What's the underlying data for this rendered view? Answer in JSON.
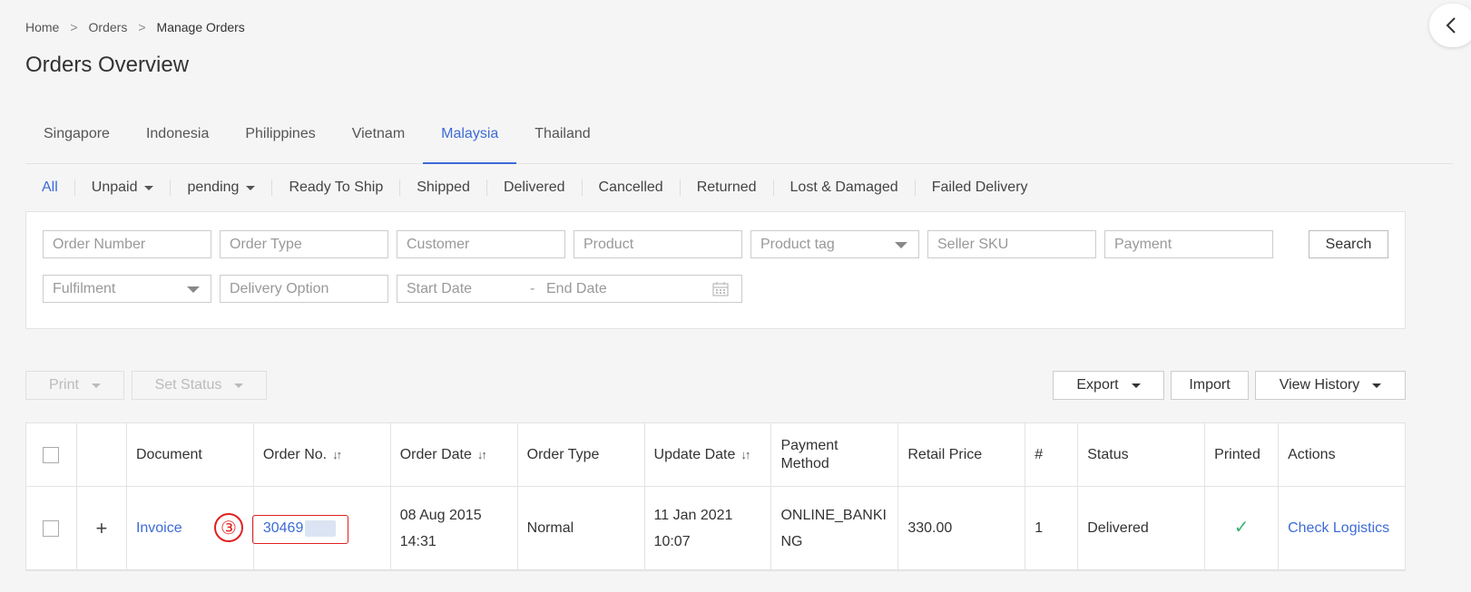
{
  "breadcrumb": [
    "Home",
    "Orders",
    "Manage Orders"
  ],
  "breadcrumb_sep": ">",
  "page_title": "Orders Overview",
  "country_tabs": [
    {
      "label": "Singapore",
      "active": false
    },
    {
      "label": "Indonesia",
      "active": false
    },
    {
      "label": "Philippines",
      "active": false
    },
    {
      "label": "Vietnam",
      "active": false
    },
    {
      "label": "Malaysia",
      "active": true
    },
    {
      "label": "Thailand",
      "active": false
    }
  ],
  "status_tabs": [
    {
      "label": "All",
      "active": true,
      "dropdown": false
    },
    {
      "label": "Unpaid",
      "active": false,
      "dropdown": true
    },
    {
      "label": "pending",
      "active": false,
      "dropdown": true
    },
    {
      "label": "Ready To Ship",
      "active": false,
      "dropdown": false
    },
    {
      "label": "Shipped",
      "active": false,
      "dropdown": false
    },
    {
      "label": "Delivered",
      "active": false,
      "dropdown": false
    },
    {
      "label": "Cancelled",
      "active": false,
      "dropdown": false
    },
    {
      "label": "Returned",
      "active": false,
      "dropdown": false
    },
    {
      "label": "Lost & Damaged",
      "active": false,
      "dropdown": false
    },
    {
      "label": "Failed Delivery",
      "active": false,
      "dropdown": false
    }
  ],
  "filters": {
    "order_number": {
      "placeholder": "Order Number",
      "value": ""
    },
    "order_type": {
      "placeholder": "Order Type",
      "value": ""
    },
    "customer": {
      "placeholder": "Customer",
      "value": ""
    },
    "product": {
      "placeholder": "Product",
      "value": ""
    },
    "product_tag": {
      "placeholder": "Product tag",
      "value": ""
    },
    "seller_sku": {
      "placeholder": "Seller SKU",
      "value": ""
    },
    "payment": {
      "placeholder": "Payment",
      "value": ""
    },
    "fulfilment": {
      "placeholder": "Fulfilment",
      "value": ""
    },
    "delivery_option": {
      "placeholder": "Delivery Option",
      "value": ""
    },
    "start_date": {
      "placeholder": "Start Date"
    },
    "date_sep": "-",
    "end_date": {
      "placeholder": "End Date"
    },
    "search_label": "Search"
  },
  "toolbar": {
    "print_label": "Print",
    "set_status_label": "Set Status",
    "export_label": "Export",
    "import_label": "Import",
    "view_history_label": "View History"
  },
  "table": {
    "columns": {
      "document": "Document",
      "order_no": "Order No.",
      "order_date": "Order Date",
      "order_type": "Order Type",
      "update_date": "Update Date",
      "payment_method_1": "Payment",
      "payment_method_2": "Method",
      "retail_price": "Retail Price",
      "count": "#",
      "status": "Status",
      "printed": "Printed",
      "actions": "Actions"
    },
    "sort_glyph": "↓↑",
    "expand_glyph": "+",
    "rows": [
      {
        "document": "Invoice",
        "order_no": "30469",
        "order_date_1": "08 Aug 2015",
        "order_date_2": "14:31",
        "order_type": "Normal",
        "update_date_1": "11 Jan 2021",
        "update_date_2": "10:07",
        "payment_method_1": "ONLINE_BANKI",
        "payment_method_2": "NG",
        "retail_price": "330.00",
        "count": "1",
        "status": "Delivered",
        "printed_glyph": "✓",
        "action": "Check Logistics"
      }
    ]
  },
  "annotation": {
    "step_label": "③",
    "color": "#e02020"
  },
  "colors": {
    "accent": "#3d6bd6",
    "success": "#3cb371"
  }
}
